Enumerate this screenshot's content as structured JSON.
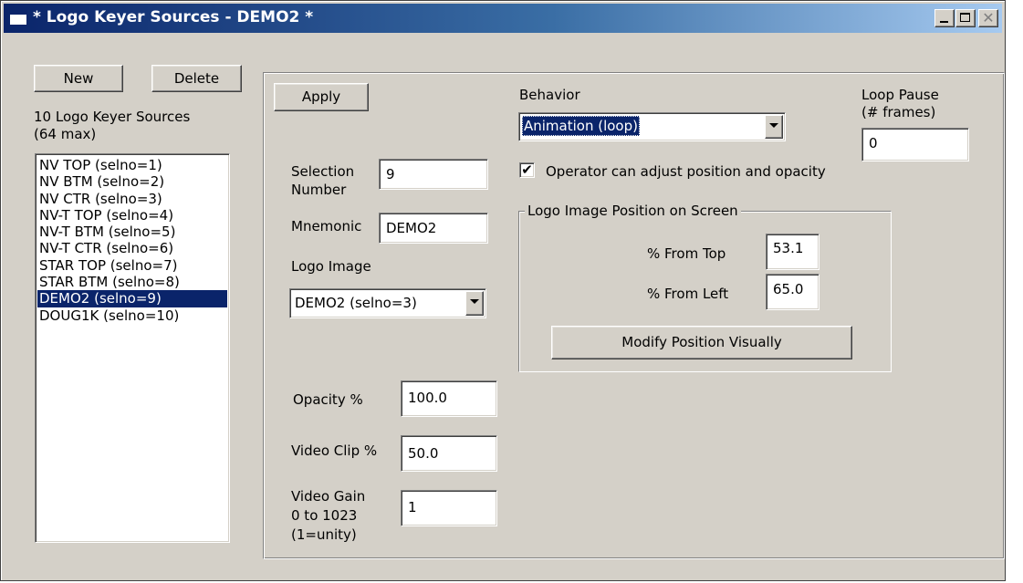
{
  "window": {
    "title": "* Logo Keyer Sources - DEMO2 *",
    "minimize_icon": "minimize-icon",
    "maximize_icon": "maximize-icon",
    "close_icon": "close-icon",
    "close_glyph": "✕"
  },
  "left": {
    "new_label": "New",
    "delete_label": "Delete",
    "count_line1": "10 Logo Keyer Sources",
    "count_line2": "(64 max)",
    "items": [
      {
        "label": "NV TOP (selno=1)"
      },
      {
        "label": "NV BTM (selno=2)"
      },
      {
        "label": "NV CTR (selno=3)"
      },
      {
        "label": "NV-T TOP (selno=4)"
      },
      {
        "label": "NV-T BTM (selno=5)"
      },
      {
        "label": "NV-T CTR (selno=6)"
      },
      {
        "label": "STAR TOP (selno=7)"
      },
      {
        "label": "STAR BTM (selno=8)"
      },
      {
        "label": "DEMO2 (selno=9)"
      },
      {
        "label": "DOUG1K (selno=10)"
      }
    ],
    "selected_item": "DEMO2 (selno=9)"
  },
  "form": {
    "apply_label": "Apply",
    "selection_number_label_1": "Selection",
    "selection_number_label_2": "Number",
    "selection_number_value": "9",
    "mnemonic_label": "Mnemonic",
    "mnemonic_value": "DEMO2",
    "logo_image_label": "Logo Image",
    "logo_image_value": "DEMO2 (selno=3)",
    "opacity_label": "Opacity %",
    "opacity_value": "100.0",
    "video_clip_label": "Video Clip %",
    "video_clip_value": "50.0",
    "video_gain_label_1": "Video Gain",
    "video_gain_label_2": "0 to 1023",
    "video_gain_label_3": "(1=unity)",
    "video_gain_value": "1"
  },
  "behavior": {
    "label": "Behavior",
    "value": "Animation (loop)",
    "loop_pause_label_1": "Loop Pause",
    "loop_pause_label_2": "(# frames)",
    "loop_pause_value": "0",
    "operator_adjust_label": "Operator can adjust position and opacity",
    "operator_adjust_checked": true,
    "check_glyph": "✔"
  },
  "position": {
    "group_title": "Logo Image Position on Screen",
    "from_top_label": "% From Top",
    "from_top_value": "53.1",
    "from_left_label": "% From Left",
    "from_left_value": "65.0",
    "modify_button_label": "Modify Position Visually"
  }
}
